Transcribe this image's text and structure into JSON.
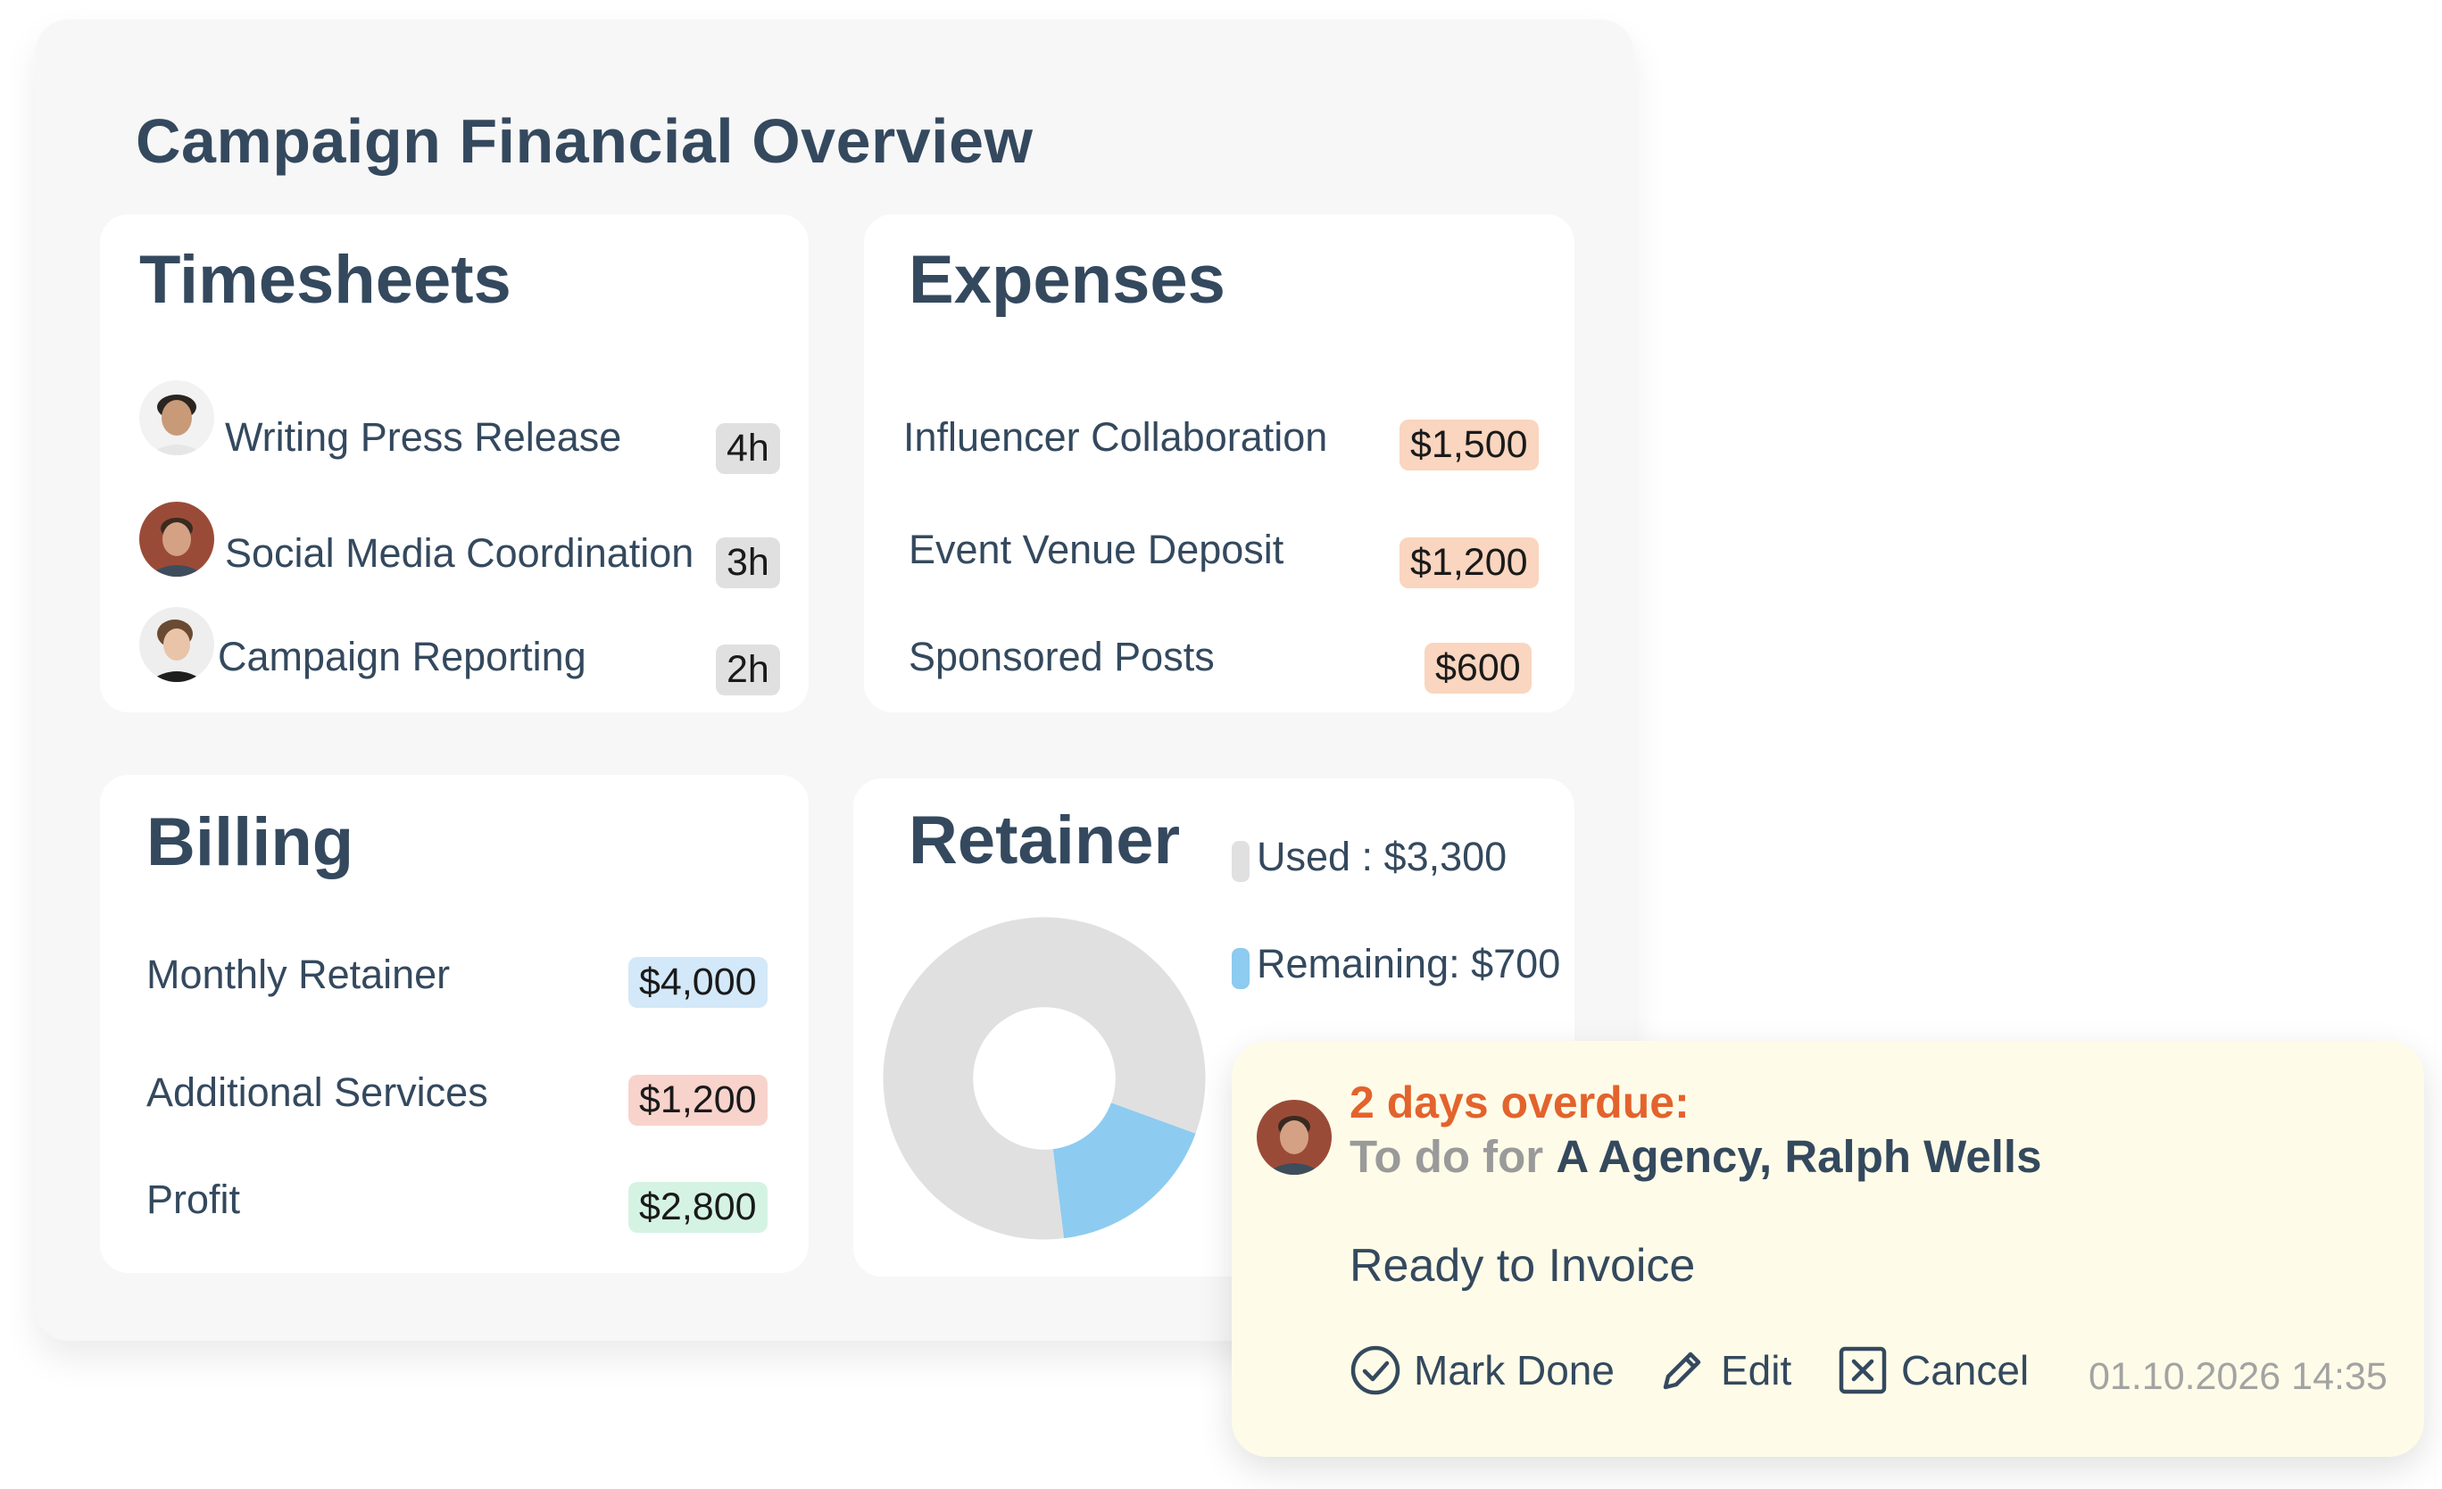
{
  "title": "Campaign Financial Overview",
  "timesheets": {
    "title": "Timesheets",
    "items": [
      {
        "label": "Writing Press Release",
        "hours": "4h"
      },
      {
        "label": "Social Media Coordination",
        "hours": "3h"
      },
      {
        "label": "Campaign Reporting",
        "hours": "2h"
      }
    ]
  },
  "expenses": {
    "title": "Expenses",
    "items": [
      {
        "label": "Influencer Collaboration",
        "amount": "$1,500"
      },
      {
        "label": "Event Venue Deposit",
        "amount": "$1,200"
      },
      {
        "label": "Sponsored Posts",
        "amount": "$600"
      }
    ]
  },
  "billing": {
    "title": "Billing",
    "items": [
      {
        "label": "Monthly Retainer",
        "amount": "$4,000"
      },
      {
        "label": "Additional Services",
        "amount": "$1,200"
      },
      {
        "label": "Profit",
        "amount": "$2,800"
      }
    ]
  },
  "retainer": {
    "title": "Retainer",
    "legend_used": "Used : $3,300",
    "legend_remaining": "Remaining: $700",
    "used": 3300,
    "remaining": 700,
    "colors": {
      "used": "#e0e0e0",
      "remaining": "#8dcbf0"
    }
  },
  "todo": {
    "overdue": "2 days overdue:",
    "prefix": "To do for",
    "assignee": "A Agency, Ralph Wells",
    "task": "Ready to Invoice",
    "actions": {
      "mark_done": "Mark Done",
      "edit": "Edit",
      "cancel": "Cancel"
    },
    "timestamp": "01.10.2026 14:35"
  },
  "colors": {
    "text": "#34495e",
    "overdue": "#e3632d",
    "panel_bg": "#f7f7f7",
    "todo_bg": "#fefce8"
  }
}
